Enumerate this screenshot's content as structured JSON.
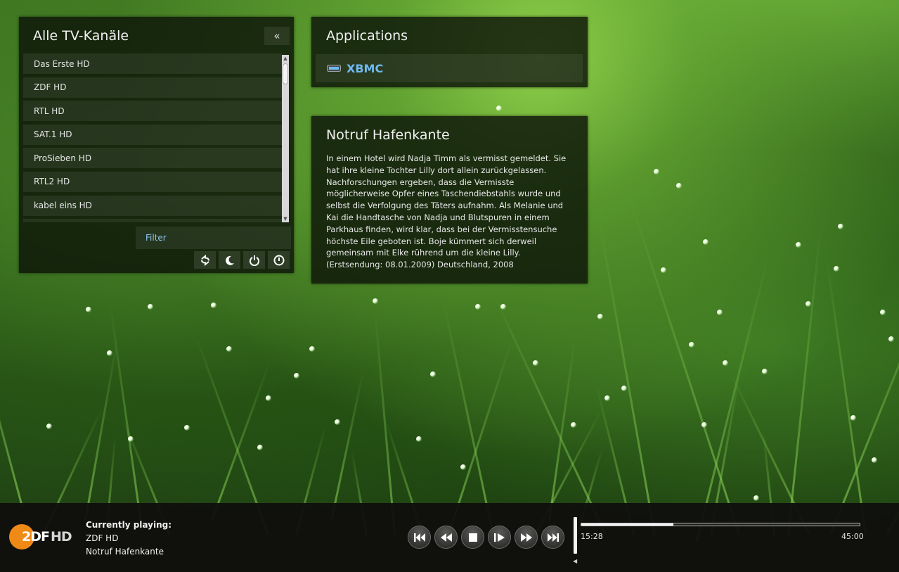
{
  "channels_panel": {
    "title": "Alle TV-Kanäle",
    "collapse_label": "«",
    "items": [
      {
        "label": "Das Erste HD"
      },
      {
        "label": "ZDF HD"
      },
      {
        "label": "RTL HD"
      },
      {
        "label": "SAT.1 HD"
      },
      {
        "label": "ProSieben HD"
      },
      {
        "label": "RTL2 HD"
      },
      {
        "label": "kabel eins HD"
      }
    ],
    "filter_placeholder": "Filter",
    "tool_icons": [
      "sync-icon",
      "sleep-icon",
      "shutdown-icon",
      "power-icon"
    ]
  },
  "apps_panel": {
    "title": "Applications",
    "items": [
      {
        "label": "XBMC",
        "icon": "xbmc-logo-icon"
      }
    ]
  },
  "program_panel": {
    "title": "Notruf Hafenkante",
    "description": "In einem Hotel wird Nadja Timm als vermisst gemeldet. Sie hat ihre kleine Tochter Lilly dort allein zurückgelassen. Nachforschungen ergeben, dass die Vermisste möglicherweise Opfer eines Taschendiebstahls wurde und selbst die Verfolgung des Täters aufnahm. Als Melanie und Kai die Handtasche von Nadja und Blutspuren in einem Parkhaus finden, wird klar, dass bei der Vermisstensuche höchste Eile geboten ist. Boje kümmert sich derweil gemeinsam mit Elke rührend um die kleine Lilly. (Erstsendung: 08.01.2009) Deutschland, 2008"
  },
  "player": {
    "logo_main": "2DF",
    "logo_hd": "HD",
    "now_playing_label": "Currently playing:",
    "channel": "ZDF HD",
    "show": "Notruf Hafenkante",
    "time_current": "15:28",
    "time_total": "45:00",
    "progress_fraction": 0.33,
    "controls": [
      "skip-back-icon",
      "rewind-icon",
      "stop-icon",
      "step-play-icon",
      "fast-forward-icon",
      "skip-forward-icon"
    ]
  },
  "colors": {
    "accent": "#6fb9f2",
    "logo_orange": "#f08a17"
  }
}
